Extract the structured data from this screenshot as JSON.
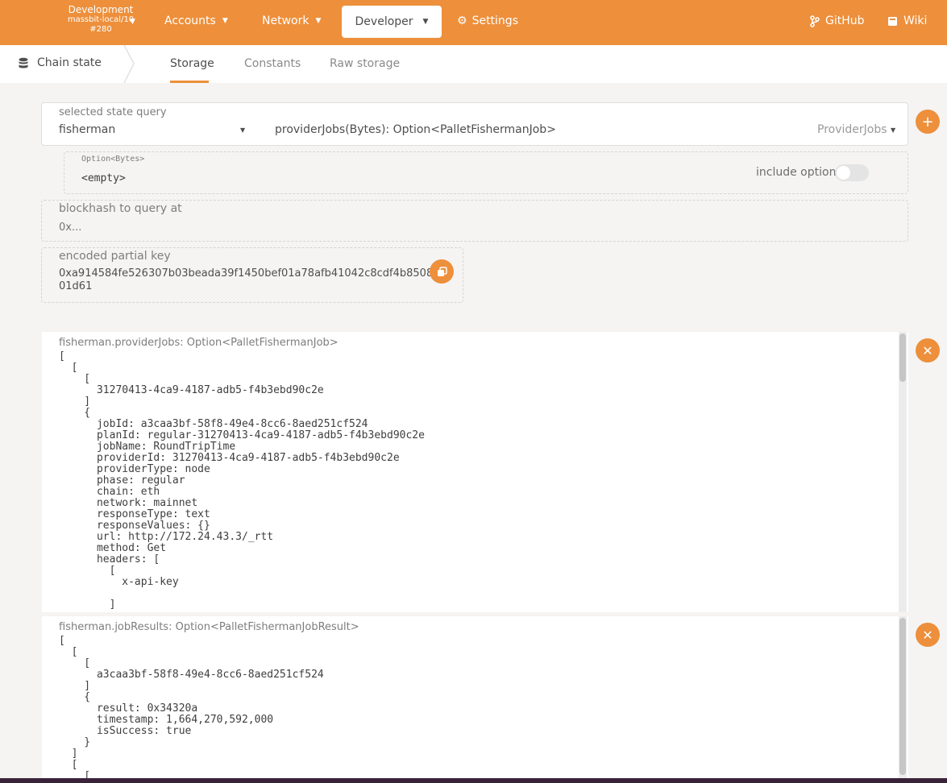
{
  "header": {
    "chain_name": "Development",
    "chain_node": "massbit-local/10",
    "chain_block": "#280",
    "nav": [
      {
        "label": "Accounts"
      },
      {
        "label": "Network"
      },
      {
        "label": "Developer"
      },
      {
        "label": "Settings"
      }
    ],
    "github_label": "GitHub",
    "wiki_label": "Wiki"
  },
  "tabs": {
    "section_label": "Chain state",
    "items": [
      "Storage",
      "Constants",
      "Raw storage"
    ],
    "active": "Storage"
  },
  "query": {
    "label": "selected state query",
    "module": "fisherman",
    "method": "providerJobs(Bytes): Option<PalletFishermanJob>",
    "method_hint": "ProviderJobs",
    "option_label": "Option<Bytes>",
    "option_value": "<empty>",
    "include_option_label": "include option",
    "include_option_on": false,
    "blockhash_label": "blockhash to query at",
    "blockhash_placeholder": "0x...",
    "partial_key_label": "encoded partial key",
    "partial_key_line1": "0xa914584fe526307b03beada39f1450bef01a78afb41042c8cdf4b85088",
    "partial_key_line2": "01d61"
  },
  "results": [
    {
      "title": "fisherman.providerJobs: Option<PalletFishermanJob>",
      "body": "[\n  [\n    [\n      31270413-4ca9-4187-adb5-f4b3ebd90c2e\n    ]\n    {\n      jobId: a3caa3bf-58f8-49e4-8cc6-8aed251cf524\n      planId: regular-31270413-4ca9-4187-adb5-f4b3ebd90c2e\n      jobName: RoundTripTime\n      providerId: 31270413-4ca9-4187-adb5-f4b3ebd90c2e\n      providerType: node\n      phase: regular\n      chain: eth\n      network: mainnet\n      responseType: text\n      responseValues: {}\n      url: http://172.24.43.3/_rtt\n      method: Get\n      headers: [\n        [\n          x-api-key\n\n        ]"
    },
    {
      "title": "fisherman.jobResults: Option<PalletFishermanJobResult>",
      "body": "[\n  [\n    [\n      a3caa3bf-58f8-49e4-8cc6-8aed251cf524\n    ]\n    {\n      result: 0x34320a\n      timestamp: 1,664,270,592,000\n      isSuccess: true\n    }\n  ]\n  [\n    ["
    }
  ],
  "colors": {
    "accent": "#ed8f3b",
    "background": "#f5f4f3"
  }
}
